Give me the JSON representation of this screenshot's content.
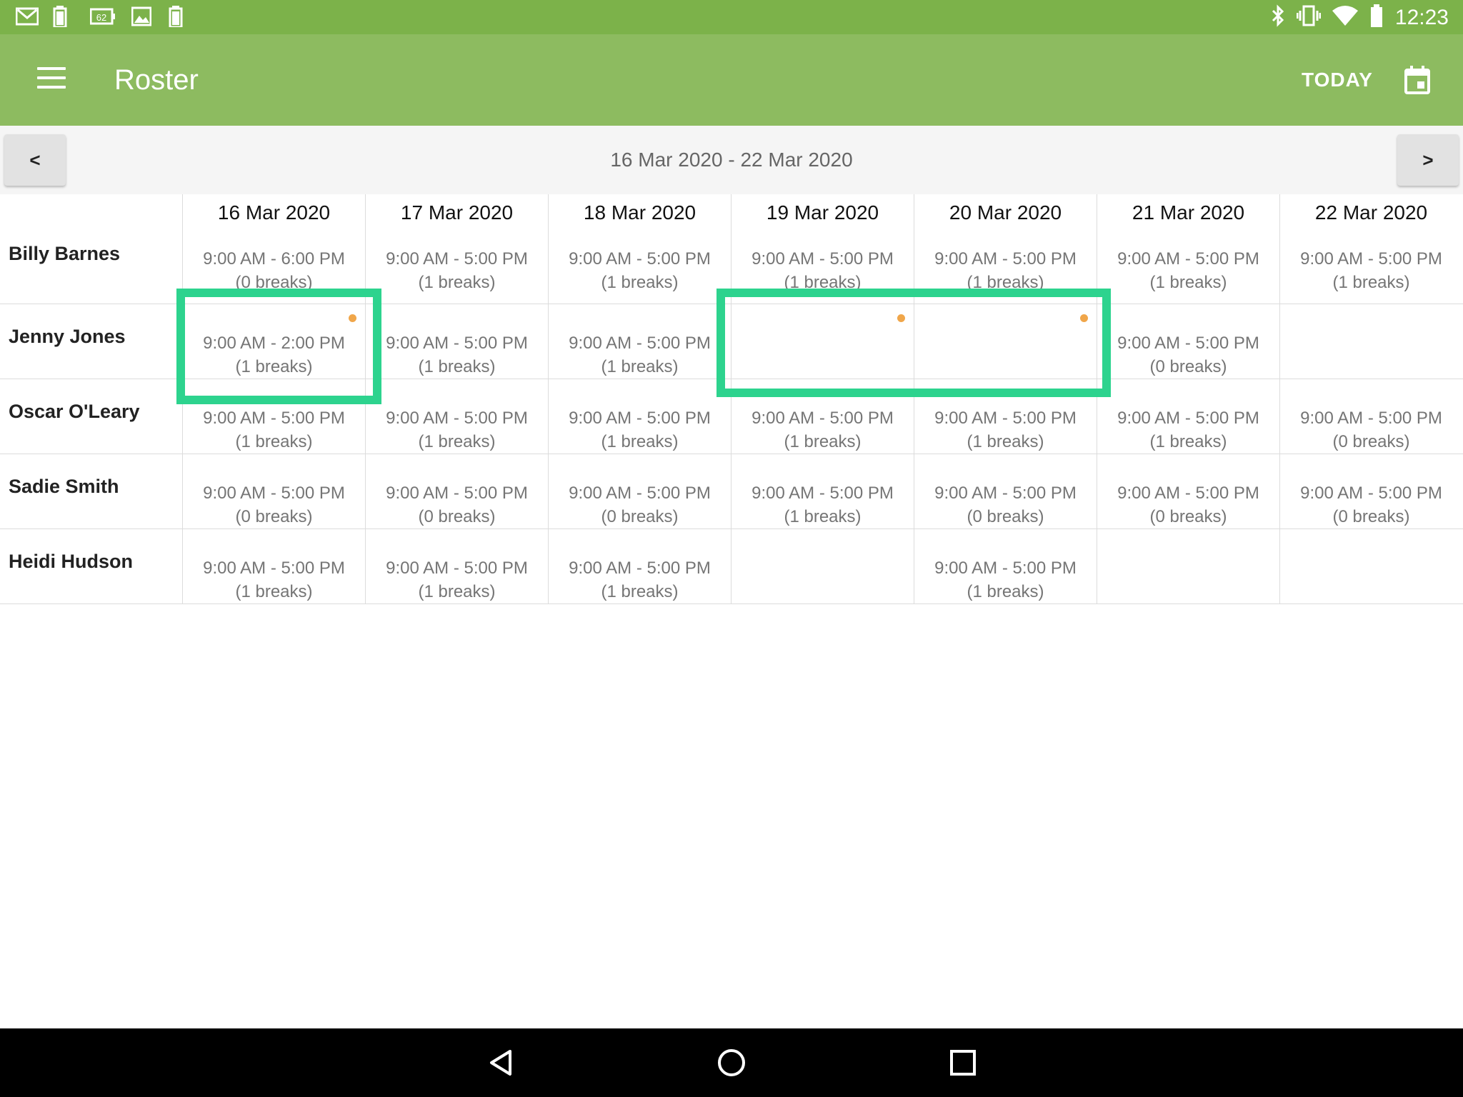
{
  "status_bar": {
    "time": "12:23",
    "battery_level": "62",
    "left_icons": [
      "gmail-icon",
      "battery-icon",
      "battery-62-icon",
      "image-icon",
      "battery-icon"
    ],
    "right_icons": [
      "bluetooth-icon",
      "vibrate-icon",
      "wifi-icon",
      "battery-icon"
    ]
  },
  "app_bar": {
    "title": "Roster",
    "today_label": "TODAY"
  },
  "week_nav": {
    "prev_label": "<",
    "next_label": ">",
    "range": "16 Mar 2020 - 22 Mar 2020"
  },
  "dates": [
    "16 Mar 2020",
    "17 Mar 2020",
    "18 Mar 2020",
    "19 Mar 2020",
    "20 Mar 2020",
    "21 Mar 2020",
    "22 Mar 2020"
  ],
  "rows": [
    {
      "name": "Billy Barnes",
      "cells": [
        {
          "time": "9:00 AM - 6:00 PM",
          "breaks": "(0 breaks)"
        },
        {
          "time": "9:00 AM - 5:00 PM",
          "breaks": "(1 breaks)"
        },
        {
          "time": "9:00 AM - 5:00 PM",
          "breaks": "(1 breaks)"
        },
        {
          "time": "9:00 AM - 5:00 PM",
          "breaks": "(1 breaks)"
        },
        {
          "time": "9:00 AM - 5:00 PM",
          "breaks": "(1 breaks)"
        },
        {
          "time": "9:00 AM - 5:00 PM",
          "breaks": "(1 breaks)"
        },
        {
          "time": "9:00 AM - 5:00 PM",
          "breaks": "(1 breaks)"
        }
      ]
    },
    {
      "name": "Jenny Jones",
      "cells": [
        {
          "time": "9:00 AM - 2:00 PM",
          "breaks": "(1 breaks)",
          "dot": true
        },
        {
          "time": "9:00 AM - 5:00 PM",
          "breaks": "(1 breaks)"
        },
        {
          "time": "9:00 AM - 5:00 PM",
          "breaks": "(1 breaks)"
        },
        {
          "time": "",
          "breaks": "",
          "dot": true
        },
        {
          "time": "",
          "breaks": "",
          "dot": true
        },
        {
          "time": "9:00 AM - 5:00 PM",
          "breaks": "(0 breaks)"
        },
        {
          "time": "",
          "breaks": ""
        }
      ]
    },
    {
      "name": "Oscar O'Leary",
      "cells": [
        {
          "time": "9:00 AM - 5:00 PM",
          "breaks": "(1 breaks)"
        },
        {
          "time": "9:00 AM - 5:00 PM",
          "breaks": "(1 breaks)"
        },
        {
          "time": "9:00 AM - 5:00 PM",
          "breaks": "(1 breaks)"
        },
        {
          "time": "9:00 AM - 5:00 PM",
          "breaks": "(1 breaks)"
        },
        {
          "time": "9:00 AM - 5:00 PM",
          "breaks": "(1 breaks)"
        },
        {
          "time": "9:00 AM - 5:00 PM",
          "breaks": "(1 breaks)"
        },
        {
          "time": "9:00 AM - 5:00 PM",
          "breaks": "(0 breaks)"
        }
      ]
    },
    {
      "name": "Sadie Smith",
      "cells": [
        {
          "time": "9:00 AM - 5:00 PM",
          "breaks": "(0 breaks)"
        },
        {
          "time": "9:00 AM - 5:00 PM",
          "breaks": "(0 breaks)"
        },
        {
          "time": "9:00 AM - 5:00 PM",
          "breaks": "(0 breaks)"
        },
        {
          "time": "9:00 AM - 5:00 PM",
          "breaks": "(1 breaks)"
        },
        {
          "time": "9:00 AM - 5:00 PM",
          "breaks": "(0 breaks)"
        },
        {
          "time": "9:00 AM - 5:00 PM",
          "breaks": "(0 breaks)"
        },
        {
          "time": "9:00 AM - 5:00 PM",
          "breaks": "(0 breaks)"
        }
      ]
    },
    {
      "name": "Heidi Hudson",
      "cells": [
        {
          "time": "9:00 AM - 5:00 PM",
          "breaks": "(1 breaks)"
        },
        {
          "time": "9:00 AM - 5:00 PM",
          "breaks": "(1 breaks)"
        },
        {
          "time": "9:00 AM - 5:00 PM",
          "breaks": "(1 breaks)"
        },
        {
          "time": "",
          "breaks": ""
        },
        {
          "time": "9:00 AM - 5:00 PM",
          "breaks": "(1 breaks)"
        },
        {
          "time": "",
          "breaks": ""
        },
        {
          "time": "",
          "breaks": ""
        }
      ]
    }
  ],
  "colors": {
    "status_bar": "#7cb24a",
    "app_bar": "#8dbb60",
    "highlight": "#2dd38e",
    "dot": "#f0a64a"
  },
  "system_nav": [
    "back-icon",
    "home-icon",
    "recents-icon"
  ]
}
